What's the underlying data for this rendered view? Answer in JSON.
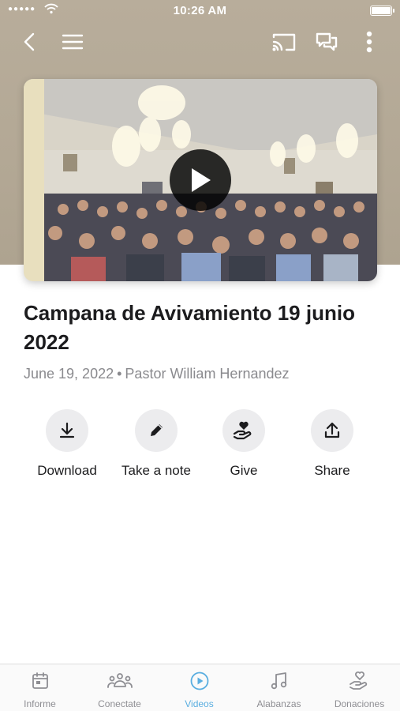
{
  "status_bar": {
    "time": "10:26 AM",
    "signal": "●●●●●"
  },
  "nav": {
    "back_icon": "chevron-left-icon",
    "menu_icon": "hamburger-menu-icon",
    "cast_icon": "cast-icon",
    "chat_icon": "chat-bubbles-icon",
    "more_icon": "more-vertical-icon"
  },
  "video": {
    "play_icon": "play-icon"
  },
  "sermon": {
    "title": "Campana de Avivamiento 19 junio 2022",
    "date": "June 19, 2022",
    "separator": "•",
    "speaker": "Pastor William Hernandez"
  },
  "actions": [
    {
      "label": "Download",
      "icon": "download-icon"
    },
    {
      "label": "Take a note",
      "icon": "pencil-icon"
    },
    {
      "label": "Give",
      "icon": "give-heart-hand-icon"
    },
    {
      "label": "Share",
      "icon": "share-icon"
    }
  ],
  "tabs": [
    {
      "label": "Informe",
      "icon": "calendar-icon",
      "active": false
    },
    {
      "label": "Conectate",
      "icon": "people-group-icon",
      "active": false
    },
    {
      "label": "Videos",
      "icon": "play-circle-icon",
      "active": true
    },
    {
      "label": "Alabanzas",
      "icon": "music-note-icon",
      "active": false
    },
    {
      "label": "Donaciones",
      "icon": "heart-hand-icon",
      "active": false
    }
  ],
  "colors": {
    "accent": "#5aaee0",
    "header_bg": "#b3a895",
    "muted_text": "#8a8a8e"
  }
}
